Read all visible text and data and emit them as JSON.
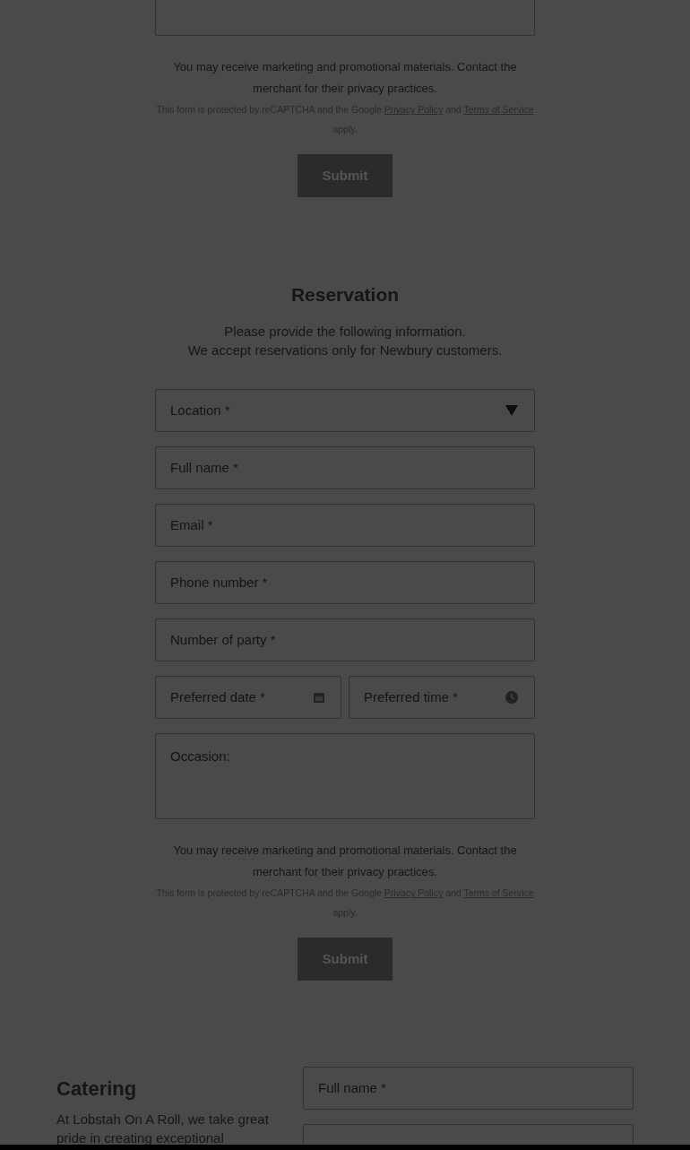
{
  "top_form": {
    "notice": "You may receive marketing and promotional materials. Contact the merchant for their privacy practices.",
    "recaptcha": {
      "before": "This form is protected by reCAPTCHA and the Google",
      "privacy_link": "Privacy Policy",
      "middle": "and",
      "terms_link": "Terms of Service",
      "after": "apply."
    },
    "submit": "Submit"
  },
  "reservation": {
    "title": "Reservation",
    "intro": [
      "Please provide the following information.",
      "We accept reservations only for Newbury customers."
    ],
    "fields": [
      {
        "kind": "select",
        "placeholder": "Location *"
      },
      {
        "kind": "text",
        "placeholder": "Full name *"
      },
      {
        "kind": "text",
        "placeholder": "Email *"
      },
      {
        "kind": "text",
        "placeholder": "Phone number *"
      },
      {
        "kind": "text",
        "placeholder": "Number of party *"
      },
      {
        "kind": "pair",
        "items": [
          {
            "kind": "date",
            "placeholder": "Preferred date *"
          },
          {
            "kind": "time",
            "placeholder": "Preferred time *"
          }
        ]
      },
      {
        "kind": "textarea",
        "placeholder": "Occasion:"
      }
    ],
    "notice": "You may receive marketing and promotional materials. Contact the merchant for their privacy practices.",
    "recaptcha": {
      "before": "This form is protected by reCAPTCHA and the Google",
      "privacy_link": "Privacy Policy",
      "middle": "and",
      "terms_link": "Terms of Service",
      "after": "apply."
    },
    "submit": "Submit"
  },
  "catering": {
    "title": "Catering",
    "intro_lines": [
      "At Lobstah On A Roll, we take great",
      "pride in creating exceptional"
    ],
    "fields": [
      {
        "kind": "text",
        "placeholder": "Full name *"
      },
      {
        "kind": "text"
      }
    ]
  }
}
